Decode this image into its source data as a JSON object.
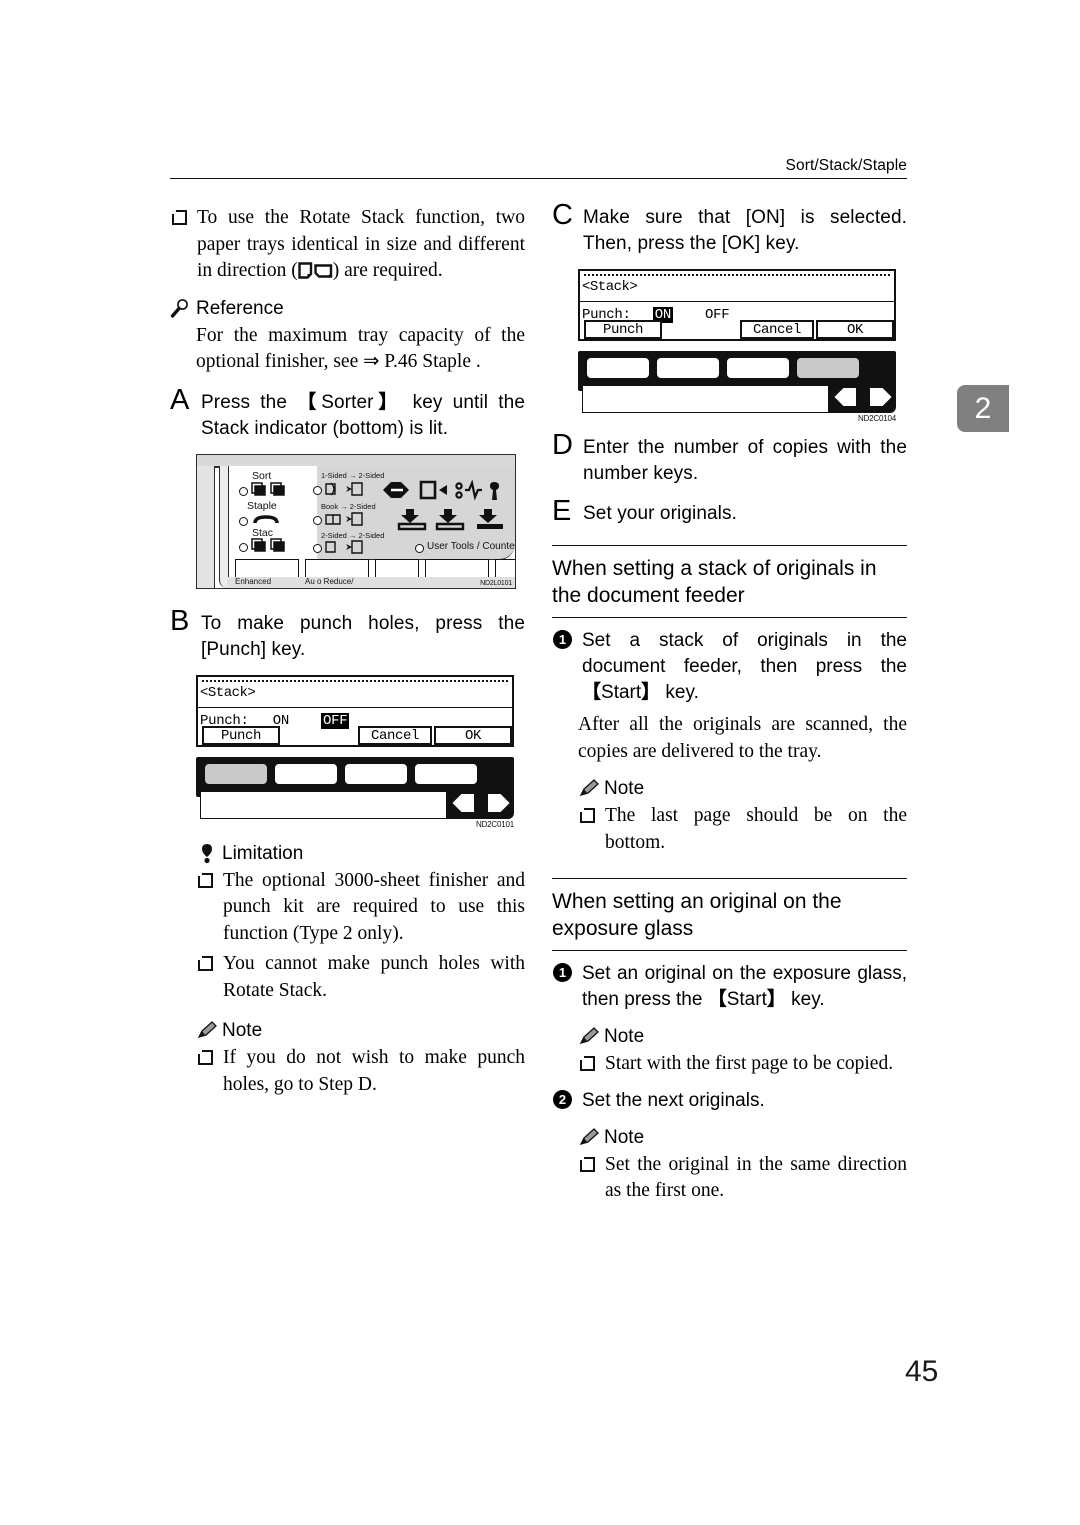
{
  "header": {
    "running_head": "Sort/Stack/Staple",
    "chapter_tab": "2",
    "page_number": "45"
  },
  "left_column": {
    "bullet_rotate_stack": "To use the Rotate Stack function, two paper trays identical in size and different in direction (  ) are required.",
    "reference": {
      "icon": "magnifier-icon",
      "label": "Reference",
      "body": "For the maximum tray capacity of the optional finisher, see ⇒ P.46 Staple ."
    },
    "step_a": {
      "letter": "A",
      "text_1": "Press the ",
      "key": "Sorter",
      "text_2": " key until the Stack indicator (bottom) is lit."
    },
    "control_panel_figure": {
      "code": "ND2L0101",
      "left_group": [
        "Sort",
        "Staple",
        "Stac"
      ],
      "mid_group": [
        "1-Sided → 2-Sided",
        "Book → 2-Sided",
        "2-Sided → 2-Sided"
      ],
      "user_tools": "User Tools / Counter",
      "bottom_labels": [
        "Enhanced",
        "Au o Reduce/"
      ]
    },
    "step_b": {
      "letter": "B",
      "text_1": "To make punch holes, press the ",
      "key": "Punch",
      "text_2": " key."
    },
    "lcd_b": {
      "title": "<Stack>",
      "field_label": "Punch:",
      "option_on": "ON",
      "option_off": "OFF",
      "selected": "OFF",
      "soft_left": "Punch",
      "soft_cancel": "Cancel",
      "soft_ok": "OK",
      "highlighted_key": 1,
      "code": "ND2C0101"
    },
    "limitation": {
      "icon": "limitation-icon",
      "label": "Limitation",
      "items": [
        "The optional 3000-sheet finisher and punch kit are required to use this function (Type 2 only).",
        "You cannot make punch holes with Rotate Stack."
      ]
    },
    "note": {
      "icon": "note-pencil-icon",
      "label": "Note",
      "items": [
        "If you do not wish to make punch holes, go to Step D."
      ]
    }
  },
  "right_column": {
    "step_c": {
      "letter": "C",
      "text": "Make sure that [ON] is selected. Then, press the [OK] key."
    },
    "lcd_c": {
      "title": "<Stack>",
      "field_label": "Punch:",
      "option_on": "ON",
      "option_off": "OFF",
      "selected": "ON",
      "soft_left": "Punch",
      "soft_cancel": "Cancel",
      "soft_ok": "OK",
      "highlighted_key": 4,
      "code": "ND2C0104"
    },
    "step_d": {
      "letter": "D",
      "text": "Enter the number of copies with the number keys."
    },
    "step_e": {
      "letter": "E",
      "text": "Set your originals."
    },
    "section_feeder": {
      "title": "When setting a stack of originals in the document feeder",
      "step_1": {
        "num": "1",
        "text_1": "Set a stack of originals in the document feeder, then press the ",
        "key": "Start",
        "text_2": " key."
      },
      "body": "After all the originals are scanned, the copies are delivered to the tray.",
      "note": {
        "icon": "note-pencil-icon",
        "label": "Note",
        "items": [
          "The last page should be on the bottom."
        ]
      }
    },
    "section_glass": {
      "title": "When setting an original on the exposure glass",
      "step_1": {
        "num": "1",
        "text_1": "Set an original on the exposure glass, then press the ",
        "key": "Start",
        "text_2": " key."
      },
      "note_1": {
        "icon": "note-pencil-icon",
        "label": "Note",
        "items": [
          "Start with the first page to be copied."
        ]
      },
      "step_2": {
        "num": "2",
        "text": "Set the next originals."
      },
      "note_2": {
        "icon": "note-pencil-icon",
        "label": "Note",
        "items": [
          "Set the original in the same direction as the first one."
        ]
      }
    }
  }
}
